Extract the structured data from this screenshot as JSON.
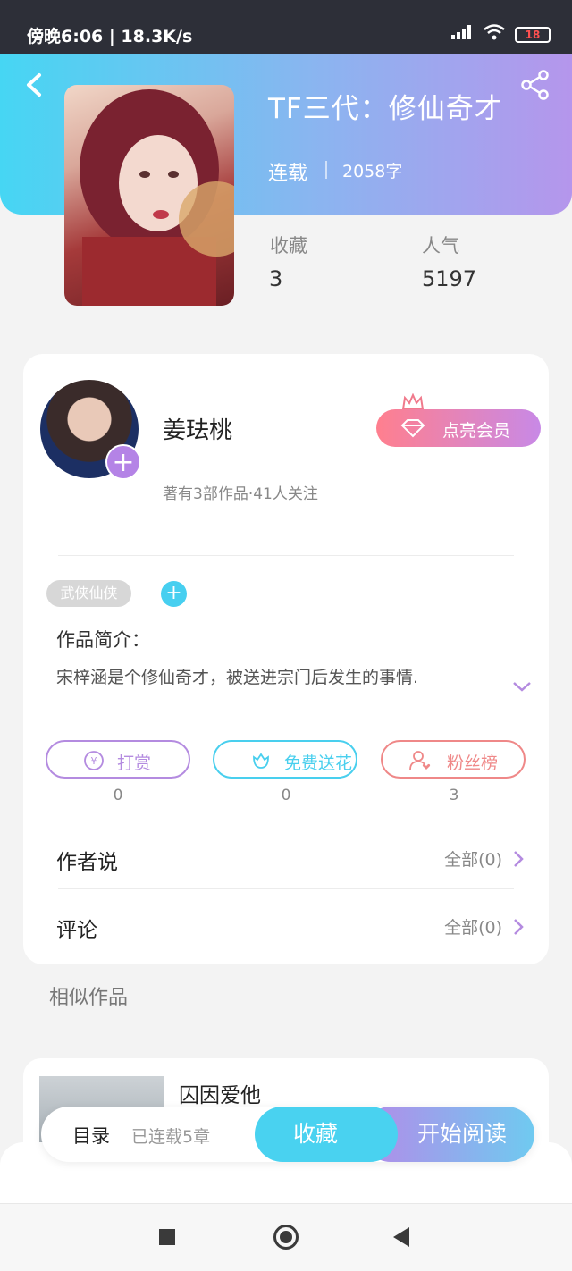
{
  "status_bar": {
    "time": "傍晚6:06 | 18.3K/s",
    "battery": "18"
  },
  "book": {
    "title": "TF三代：修仙奇才",
    "status": "连载",
    "words": "2058字",
    "stats": [
      {
        "label": "收藏",
        "value": "3"
      },
      {
        "label": "人气",
        "value": "5197"
      }
    ]
  },
  "author": {
    "name": "姜珐桃",
    "meta": "著有3部作品·41人关注",
    "vip_label": "点亮会员"
  },
  "tag": "武侠仙侠",
  "intro": {
    "label": "作品简介：",
    "text": "宋梓涵是个修仙奇才，被送进宗门后发生的事情."
  },
  "actions": [
    {
      "label": "打赏",
      "count": "0",
      "color": "#b48be0",
      "icon": "yuan-coin-icon"
    },
    {
      "label": "免费送花",
      "count": "0",
      "color": "#49cfee",
      "icon": "flower-icon"
    },
    {
      "label": "粉丝榜",
      "count": "3",
      "color": "#ef8888",
      "icon": "fan-user-icon"
    }
  ],
  "rows": [
    {
      "label": "作者说",
      "right": "全部(0)"
    },
    {
      "label": "评论",
      "right": "全部(0)"
    }
  ],
  "similar": {
    "heading": "相似作品",
    "items": [
      {
        "title": "囚因爱他"
      }
    ]
  },
  "bottom_bar": {
    "toc": "目录",
    "toc_sub": "已连载5章",
    "fav": "收藏",
    "read": "开始阅读"
  }
}
